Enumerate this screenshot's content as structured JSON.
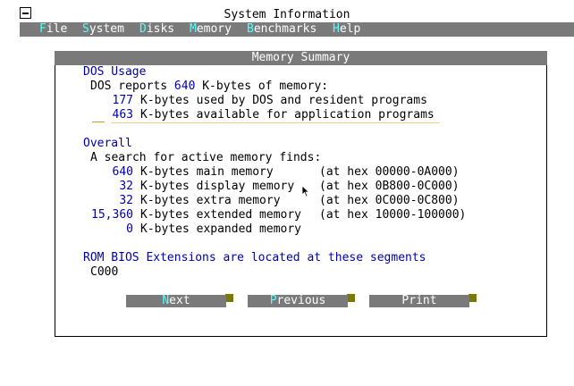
{
  "window": {
    "title": "System Information"
  },
  "menu": [
    {
      "hot": "F",
      "rest": "ile"
    },
    {
      "hot": "S",
      "rest": "ystem"
    },
    {
      "hot": "D",
      "rest": "isks"
    },
    {
      "hot": "M",
      "rest": "emory"
    },
    {
      "hot": "B",
      "rest": "enchmarks"
    },
    {
      "hot": "H",
      "rest": "elp"
    }
  ],
  "dialog": {
    "title": "Memory Summary",
    "dos_usage": {
      "heading": "DOS Usage",
      "reports_prefix": "DOS reports",
      "reports_value": "640",
      "reports_suffix": "K-bytes of memory:",
      "used_value": "177",
      "used_label": "K-bytes used by DOS and resident programs",
      "available_value": "463",
      "available_label": "K-bytes available for application programs"
    },
    "overall": {
      "heading": "Overall",
      "intro": "A search for active memory finds:",
      "rows": [
        {
          "value": "640",
          "label": "K-bytes main memory",
          "range": "(at hex 00000-0A000)"
        },
        {
          "value": "32",
          "label": "K-bytes display memory",
          "range": "(at hex 0B800-0C000)"
        },
        {
          "value": "32",
          "label": "K-bytes extra memory",
          "range": "(at hex 0C000-0C800)"
        },
        {
          "value": "15,360",
          "label": "K-bytes extended memory",
          "range": "(at hex 10000-100000)"
        },
        {
          "value": "0",
          "label": "K-bytes expanded memory",
          "range": ""
        }
      ]
    },
    "rom": {
      "heading": "ROM BIOS Extensions are located at these segments",
      "segments": "C000"
    },
    "buttons": {
      "next": {
        "hot": "N",
        "rest": "ext"
      },
      "previous": {
        "hot": "P",
        "rest": "revious"
      },
      "print": {
        "hot": "",
        "rest": "Print"
      }
    }
  }
}
